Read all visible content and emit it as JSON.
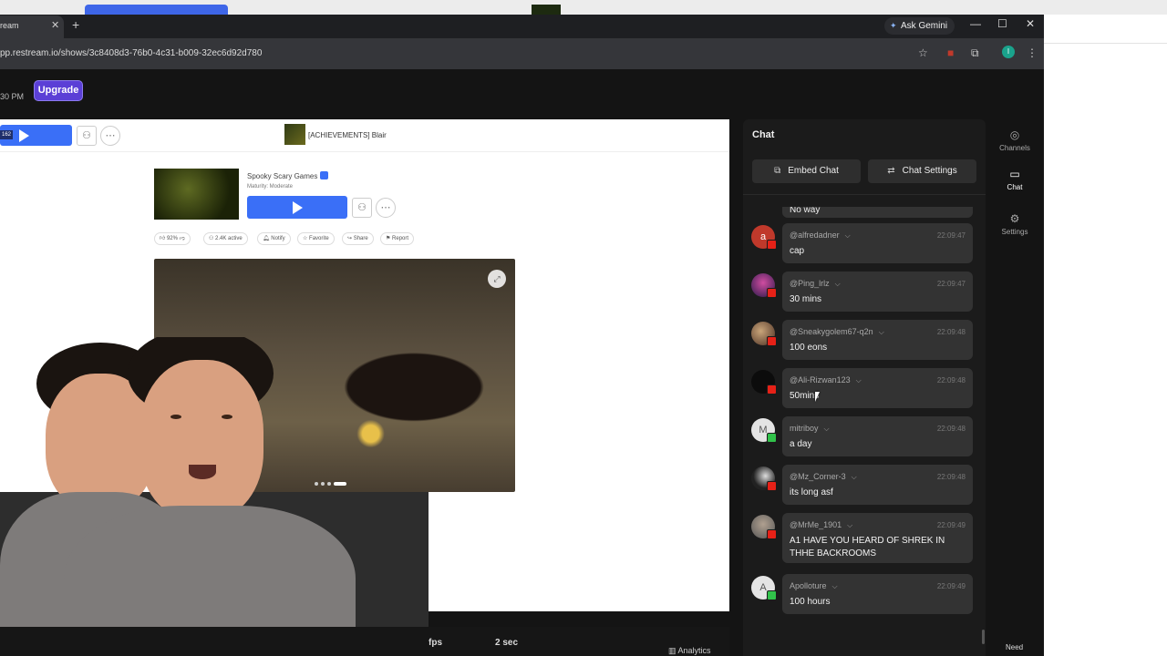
{
  "browser": {
    "tab_title": "ream",
    "url": "pp.restream.io/shows/3c8408d3-76b0-4c31-b009-32ec6d92d780",
    "gemini_label": "Ask Gemini",
    "profile_initial": "I"
  },
  "app": {
    "clock": "30 PM",
    "upgrade_label": "Upgrade"
  },
  "shared_screen": {
    "live_count": "162",
    "game_title": "[ACHIEVEMENTS] Blair",
    "creator": "Spooky Scary Games",
    "maturity": "Maturity: Moderate",
    "stats": [
      "92%",
      "2.4K active",
      "Notify",
      "Favorite",
      "Share",
      "Report"
    ]
  },
  "status_bar": {
    "fps": "fps",
    "delay": "2 sec",
    "analytics": "Analytics"
  },
  "chat": {
    "title": "Chat",
    "embed_label": "Embed Chat",
    "settings_label": "Chat Settings",
    "top_partial": "No way",
    "messages": [
      {
        "user": "@alfredadner",
        "time": "22:09:47",
        "text": "cap",
        "avatar": "a",
        "avatar_color": "#c0392b",
        "platform": "youtube"
      },
      {
        "user": "@Ping_lrlz",
        "time": "22:09:47",
        "text": "30 mins",
        "avatar": "",
        "avatar_color": "#5a2a7a",
        "platform": "youtube"
      },
      {
        "user": "@Sneakygolem67-q2n",
        "time": "22:09:48",
        "text": "100 eons",
        "avatar": "",
        "avatar_color": "#6b4a3a",
        "platform": "youtube"
      },
      {
        "user": "@Ali-Rizwan123",
        "time": "22:09:48",
        "text": "50mins",
        "avatar": "",
        "avatar_color": "#111111",
        "platform": "youtube"
      },
      {
        "user": "mitriboy",
        "time": "22:09:48",
        "text": "a day",
        "avatar": "M",
        "avatar_color": "#e0e0e0",
        "platform": "kick"
      },
      {
        "user": "@Mz_Corner-3",
        "time": "22:09:48",
        "text": "its long asf",
        "avatar": "",
        "avatar_color": "#3a3a3a",
        "platform": "youtube"
      },
      {
        "user": "@MrMe_1901",
        "time": "22:09:49",
        "text": "A1 HAVE YOU HEARD OF SHREK IN THHE BACKROOMS",
        "avatar": "",
        "avatar_color": "#8a8a8a",
        "platform": "youtube"
      },
      {
        "user": "Apolloture",
        "time": "22:09:49",
        "text": "100 hours",
        "avatar": "A",
        "avatar_color": "#e0e0e0",
        "platform": "kick"
      }
    ]
  },
  "rail": {
    "channels": "Channels",
    "chat": "Chat",
    "settings": "Settings",
    "need": "Need"
  },
  "colors": {
    "accent": "#5b3fd6",
    "play_blue": "#3a6ff7",
    "youtube_red": "#e62117",
    "kick_green": "#31c24a"
  }
}
